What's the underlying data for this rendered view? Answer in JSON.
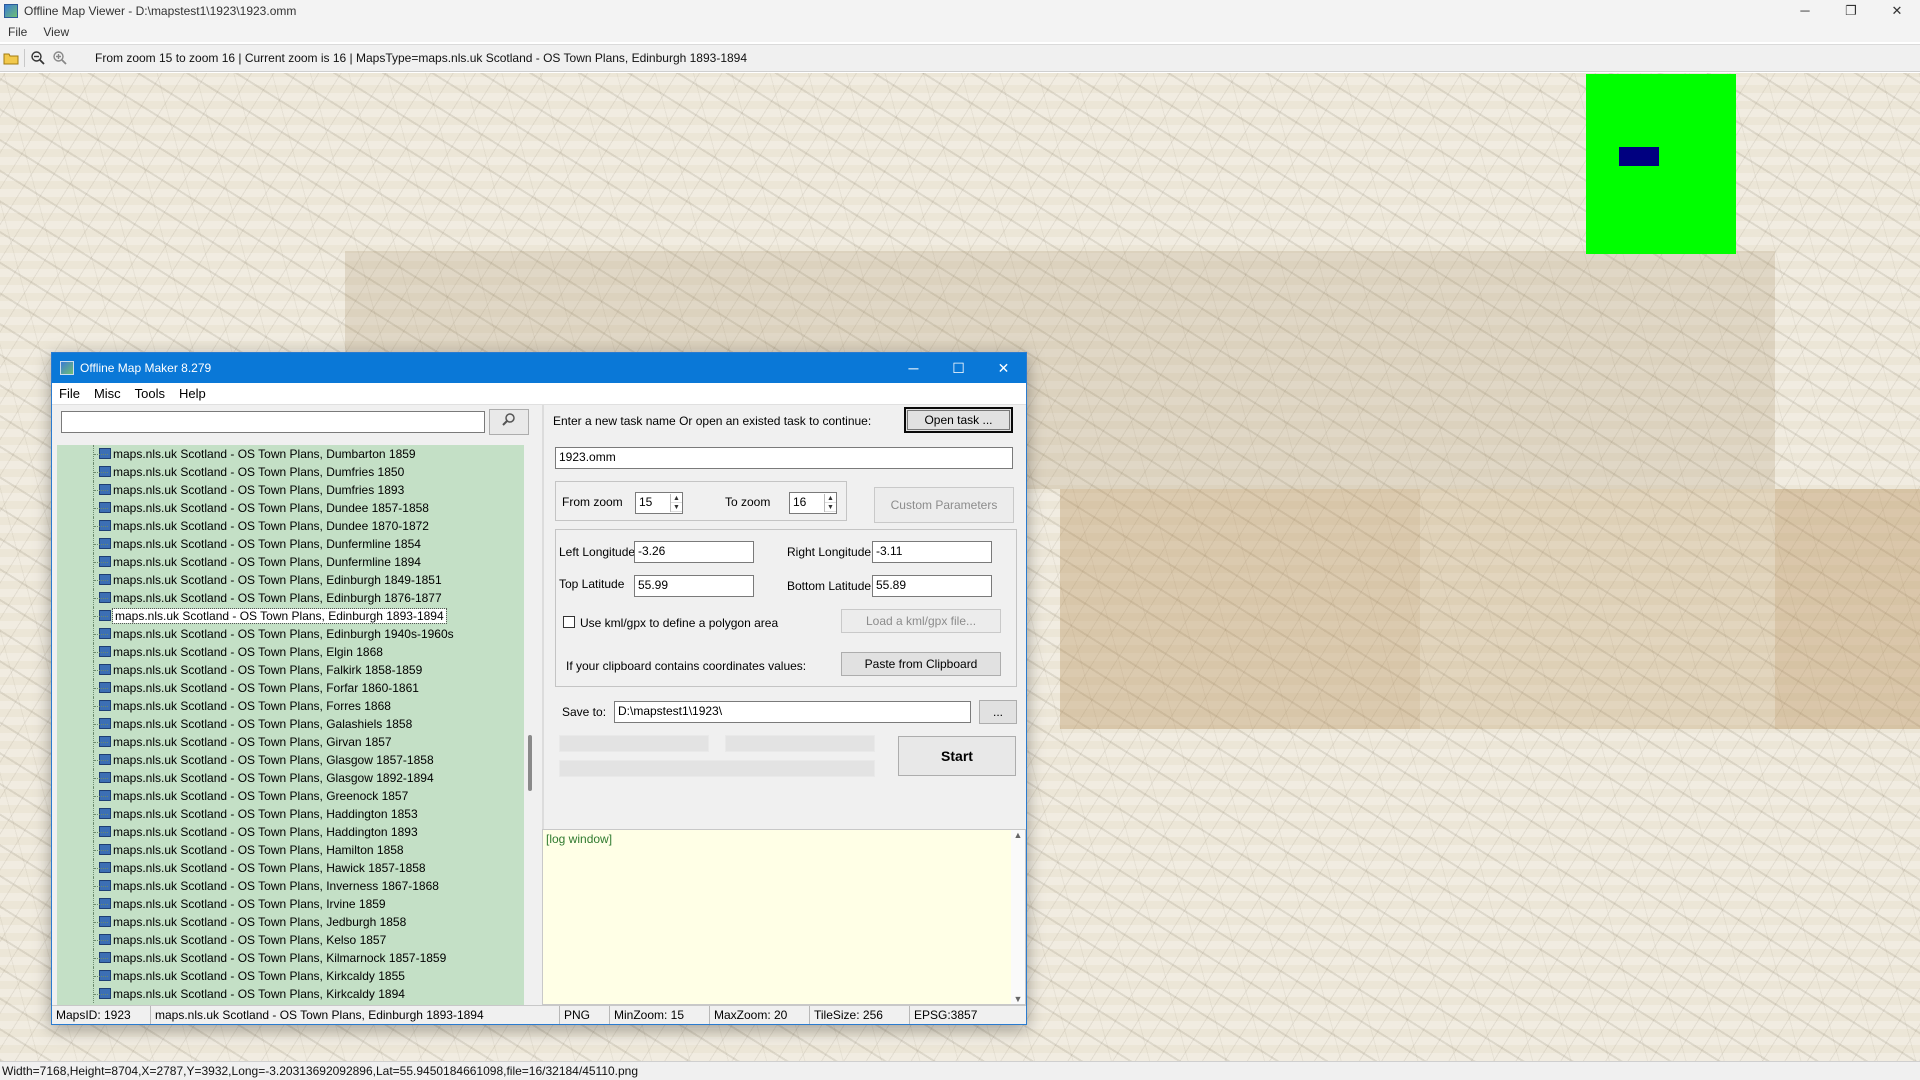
{
  "window": {
    "title": "Offline Map Viewer - D:\\mapstest1\\1923\\1923.omm",
    "controls": {
      "minimize": "─",
      "maximize": "❐",
      "close": "✕"
    }
  },
  "menu": {
    "file": "File",
    "view": "View"
  },
  "toolbar": {
    "info": "From zoom 15 to zoom 16   |   Current zoom is 16 |    MapsType=maps.nls.uk Scotland - OS Town Plans, Edinburgh 1893-1894"
  },
  "status_bar": {
    "text": "Width=7168,Height=8704,X=2787,Y=3932,Long=-3.20313692092896,Lat=55.9450184661098,file=16/32184/45110.png"
  },
  "dialog": {
    "title": "Offline Map Maker 8.279",
    "controls": {
      "minimize": "─",
      "maximize": "☐",
      "close": "✕"
    },
    "menu": {
      "file": "File",
      "misc": "Misc",
      "tools": "Tools",
      "help": "Help"
    },
    "search": {
      "value": "",
      "button_icon": "search-icon"
    },
    "maps_list": [
      "maps.nls.uk Scotland - OS Town Plans, Dumbarton 1859",
      "maps.nls.uk Scotland - OS Town Plans, Dumfries 1850",
      "maps.nls.uk Scotland - OS Town Plans, Dumfries 1893",
      "maps.nls.uk Scotland - OS Town Plans, Dundee 1857-1858",
      "maps.nls.uk Scotland - OS Town Plans, Dundee 1870-1872",
      "maps.nls.uk Scotland - OS Town Plans, Dunfermline 1854",
      "maps.nls.uk Scotland - OS Town Plans, Dunfermline 1894",
      "maps.nls.uk Scotland - OS Town Plans, Edinburgh 1849-1851",
      "maps.nls.uk Scotland - OS Town Plans, Edinburgh 1876-1877",
      "maps.nls.uk Scotland - OS Town Plans, Edinburgh 1893-1894",
      "maps.nls.uk Scotland - OS Town Plans, Edinburgh 1940s-1960s",
      "maps.nls.uk Scotland - OS Town Plans, Elgin 1868",
      "maps.nls.uk Scotland - OS Town Plans, Falkirk 1858-1859",
      "maps.nls.uk Scotland - OS Town Plans, Forfar 1860-1861",
      "maps.nls.uk Scotland - OS Town Plans, Forres 1868",
      "maps.nls.uk Scotland - OS Town Plans, Galashiels 1858",
      "maps.nls.uk Scotland - OS Town Plans, Girvan 1857",
      "maps.nls.uk Scotland - OS Town Plans, Glasgow 1857-1858",
      "maps.nls.uk Scotland - OS Town Plans, Glasgow 1892-1894",
      "maps.nls.uk Scotland - OS Town Plans, Greenock 1857",
      "maps.nls.uk Scotland - OS Town Plans, Haddington 1853",
      "maps.nls.uk Scotland - OS Town Plans, Haddington 1893",
      "maps.nls.uk Scotland - OS Town Plans, Hamilton 1858",
      "maps.nls.uk Scotland - OS Town Plans, Hawick 1857-1858",
      "maps.nls.uk Scotland - OS Town Plans, Inverness 1867-1868",
      "maps.nls.uk Scotland - OS Town Plans, Irvine 1859",
      "maps.nls.uk Scotland - OS Town Plans, Jedburgh 1858",
      "maps.nls.uk Scotland - OS Town Plans, Kelso 1857",
      "maps.nls.uk Scotland - OS Town Plans, Kilmarnock 1857-1859",
      "maps.nls.uk Scotland - OS Town Plans, Kirkcaldy 1855",
      "maps.nls.uk Scotland - OS Town Plans, Kirkcaldy 1894"
    ],
    "selected_index": 9,
    "task": {
      "prompt": "Enter a new task name Or open an existed task to continue:",
      "open_button": "Open task ...",
      "name_value": "1923.omm"
    },
    "zoom": {
      "from_label": "From zoom",
      "from_value": "15",
      "to_label": "To zoom",
      "to_value": "16",
      "custom_button": "Custom Parameters"
    },
    "coords": {
      "left_lon_label": "Left Longitude",
      "left_lon_value": "-3.26",
      "right_lon_label": "Right Longitude",
      "right_lon_value": "-3.11",
      "top_lat_label": "Top Latitude",
      "top_lat_value": "55.99",
      "bottom_lat_label": "Bottom Latitude",
      "bottom_lat_value": "55.89",
      "kml_checkbox_label": "Use kml/gpx to define a polygon area",
      "load_kml_button": "Load a kml/gpx file...",
      "clipboard_label": "If your clipboard contains coordinates values:",
      "paste_button": "Paste from Clipboard"
    },
    "save": {
      "label": "Save to:",
      "value": "D:\\mapstest1\\1923\\",
      "browse_button": "..."
    },
    "start_button": "Start",
    "log": {
      "placeholder": "[log window]"
    },
    "status": {
      "maps_id": "MapsID: 1923",
      "name": "maps.nls.uk Scotland - OS Town Plans, Edinburgh 1893-1894",
      "format": "PNG",
      "min_zoom": "MinZoom: 15",
      "max_zoom": "MaxZoom: 20",
      "tile_size": "TileSize: 256",
      "epsg": "EPSG:3857"
    }
  },
  "colors": {
    "dialog_titlebar": "#0a78d7",
    "list_background": "#c4e0c6",
    "log_background": "#ffffe6",
    "minimap_background": "#00ff00",
    "minimap_viewport": "#000080"
  }
}
